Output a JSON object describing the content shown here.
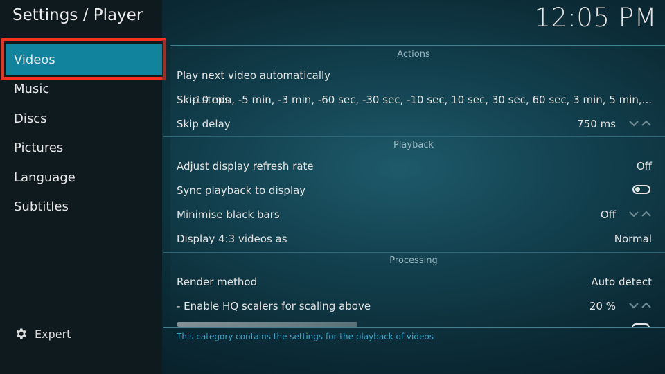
{
  "header": {
    "title": "Settings / Player",
    "clock": "12:05 PM"
  },
  "sidebar": {
    "items": [
      {
        "label": "Videos",
        "selected": true
      },
      {
        "label": "Music"
      },
      {
        "label": "Discs"
      },
      {
        "label": "Pictures"
      },
      {
        "label": "Language"
      },
      {
        "label": "Subtitles"
      }
    ],
    "expert_label": "Expert",
    "expert_icon": "gear-icon"
  },
  "sections": {
    "actions": {
      "header": "Actions",
      "play_next": {
        "label": "Play next video automatically"
      },
      "skip_steps": {
        "label": "Skip steps",
        "value": "-10 min, -5 min, -3 min, -60 sec, -30 sec, -10 sec, 10 sec, 30 sec, 60 sec, 3 min, 5 min,..."
      },
      "skip_delay": {
        "label": "Skip delay",
        "value": "750 ms"
      }
    },
    "playback": {
      "header": "Playback",
      "refresh_rate": {
        "label": "Adjust display refresh rate",
        "value": "Off"
      },
      "sync_playback": {
        "label": "Sync playback to display"
      },
      "black_bars": {
        "label": "Minimise black bars",
        "value": "Off"
      },
      "display_43": {
        "label": "Display 4:3 videos as",
        "value": "Normal"
      }
    },
    "processing": {
      "header": "Processing",
      "render_method": {
        "label": "Render method",
        "value": "Auto detect"
      },
      "hq_scalers": {
        "label": "- Enable HQ scalers for scaling above",
        "value": "20 %"
      }
    }
  },
  "hint": "This category contains the settings for the playback of videos",
  "colors": {
    "selected_bg": "#12839c",
    "highlight_border": "#f2321d",
    "hint_text": "#3ea8c8",
    "sidebar_bg": "#0f1a1f"
  }
}
